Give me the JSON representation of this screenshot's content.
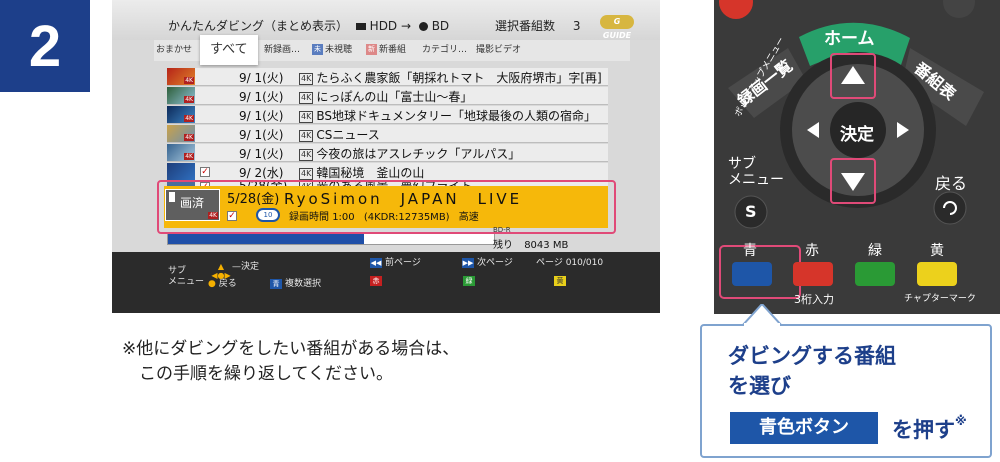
{
  "step_number": "2",
  "screen": {
    "title": "かんたんダビング（まとめ表示）",
    "src_label": "HDD →",
    "dst_label": "BD",
    "selected_count_label": "選択番組数",
    "selected_count": "3",
    "brand_badge": "G GUIDE",
    "filters": [
      {
        "label": "おまかせ",
        "icon": ""
      },
      {
        "label": "すべて",
        "icon": "",
        "active": true
      },
      {
        "label": "新録画…",
        "icon": ""
      },
      {
        "label": "未視聴",
        "icon": "未"
      },
      {
        "label": "新番組",
        "icon": "新"
      },
      {
        "label": "カテゴリ…",
        "icon": ""
      },
      {
        "label": "撮影ビデオ",
        "icon": ""
      }
    ],
    "rows": [
      {
        "date": "9/ 1(火)",
        "badge": "4K",
        "title": "たらふく農家飯「朝採れトマト　大阪府堺市」字[再]",
        "checked": false
      },
      {
        "date": "9/ 1(火)",
        "badge": "4K",
        "title": "にっぽんの山「富士山〜春」",
        "checked": false
      },
      {
        "date": "9/ 1(火)",
        "badge": "4K",
        "title": "BS地球ドキュメンタリー「地球最後の人類の宿命」",
        "checked": false
      },
      {
        "date": "9/ 1(火)",
        "badge": "4K",
        "title": "CSニュース",
        "checked": false
      },
      {
        "date": "9/ 1(火)",
        "badge": "4K",
        "title": "今夜の旅はアスレチック「アルパス」",
        "checked": false
      },
      {
        "date": "9/ 2(水)",
        "badge": "4K",
        "title": "韓国秘境　釜山の山",
        "checked": true
      },
      {
        "date": "5/28(金)",
        "badge": "4K",
        "title": "光のある風景　夢幻フライト",
        "checked": true
      }
    ],
    "selected_row": {
      "status": "画済",
      "date": "5/28(金)",
      "title": "RyoSimon　JAPAN　LIVE",
      "duration_label": "録画時間",
      "duration": "1:00",
      "detail": "(4KDR:12735MB)",
      "quality": "高速",
      "disc_count": "10"
    },
    "storage": {
      "media": "BD-R",
      "remaining_label": "残り",
      "remaining": "8043 MB",
      "used_fraction": 0.6
    },
    "footer": {
      "decide": "決定",
      "submenu": "サブ\nメニュー",
      "back": "戻る",
      "multi_select": "複数選択",
      "multi_select_key": "青",
      "prev_page": "前ページ",
      "next_page": "次ページ",
      "page_label": "ページ",
      "page": "010/010",
      "red": "赤",
      "green": "緑",
      "yellow": "黄"
    }
  },
  "note": {
    "line1": "※他にダビングをしたい番組がある場合は、",
    "line2": "　この手順を繰り返してください。"
  },
  "remote": {
    "popup_menu": "ポップアップメニュー",
    "rec_list": "録画一覧",
    "home": "ホーム",
    "guide": "番組表",
    "enter": "決定",
    "submenu": "サブ\nメニュー",
    "back": "戻る",
    "s_key": "S",
    "blue": "青",
    "red": "赤",
    "green": "緑",
    "yellow": "黄",
    "three_digit": "3桁入力",
    "chapter_mark": "チャプターマーク"
  },
  "callout": {
    "line1": "ダビングする番組",
    "line2": "を選び",
    "button": "青色ボタン",
    "push": "を押す",
    "push_mark": "※"
  },
  "colors": {
    "brand_blue": "#1d3f8a",
    "highlight": "#e04a78",
    "selected_row": "#f6b80a",
    "blue_key": "#1e56a8"
  }
}
